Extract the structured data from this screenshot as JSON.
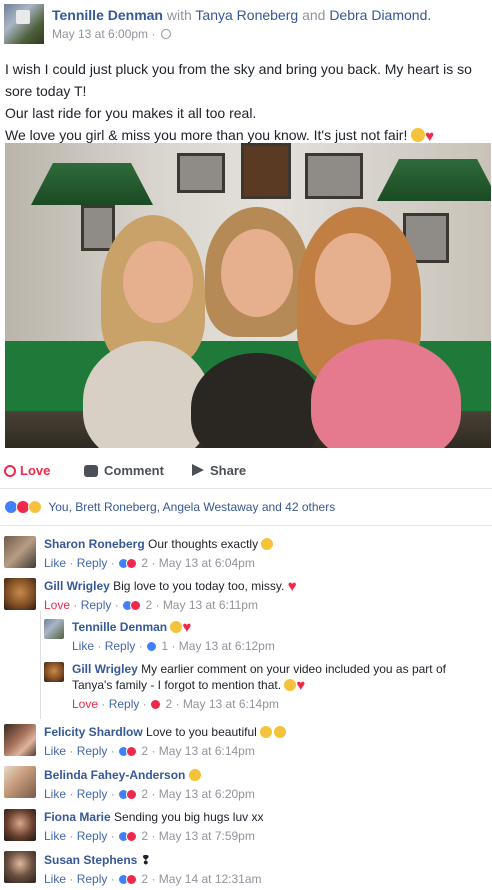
{
  "post": {
    "author": "Tennille Denman",
    "with_word": "with",
    "tag1": "Tanya Roneberg",
    "and_word": "and",
    "tag2": "Debra Diamond.",
    "timestamp": "May 13 at 6:00pm",
    "separator": "·",
    "privacy_icon": "globe-icon",
    "text_lines": [
      "I wish I could just pluck you from the sky and bring you back. My heart is so",
      "sore today T!",
      "Our last ride for you makes it all too real.",
      "We love you girl & miss you more than you know. It's just not fair!"
    ],
    "photo_icon": "photo-three-women-pool-room"
  },
  "actions": {
    "love": "Love",
    "comment": "Comment",
    "share": "Share"
  },
  "reactions": {
    "summary": "You, Brett Roneberg, Angela Westaway and 42 others",
    "icons": [
      "like-icon",
      "love-icon",
      "sad-icon"
    ]
  },
  "comments": [
    {
      "name": "Sharon Roneberg",
      "text": "Our thoughts exactly",
      "like": "Like",
      "reply": "Reply",
      "count": "2",
      "time": "May 13 at 6:04pm"
    },
    {
      "name": "Gill Wrigley",
      "text": "Big love to you today too, missy.",
      "like": "Love",
      "reply": "Reply",
      "count": "2",
      "time": "May 13 at 6:11pm"
    },
    {
      "name": "Tennille Denman",
      "text": "",
      "like": "Like",
      "reply": "Reply",
      "count": "1",
      "time": "May 13 at 6:12pm"
    },
    {
      "name": "Gill Wrigley",
      "text": "My earlier comment on your video included you as part of",
      "text2": "Tanya's family - I forgot to mention that.",
      "like": "Love",
      "reply": "Reply",
      "count": "2",
      "time": "May 13 at 6:14pm"
    },
    {
      "name": "Felicity Shardlow",
      "text": "Love to you beautiful",
      "like": "Like",
      "reply": "Reply",
      "count": "2",
      "time": "May 13 at 6:14pm"
    },
    {
      "name": "Belinda Fahey-Anderson",
      "text": "",
      "like": "Like",
      "reply": "Reply",
      "count": "2",
      "time": "May 13 at 6:20pm"
    },
    {
      "name": "Fiona Marie",
      "text": "Sending you big hugs luv xx",
      "like": "Like",
      "reply": "Reply",
      "count": "2",
      "time": "May 13 at 7:59pm"
    },
    {
      "name": "Susan Stephens",
      "text": "",
      "like": "Like",
      "reply": "Reply",
      "count": "2",
      "time": "May 14 at 12:31am"
    }
  ],
  "dot": "·",
  "colors": {
    "link": "#365899",
    "love": "#f0284a",
    "muted": "#90949c",
    "like_blue": "#4080ff"
  }
}
